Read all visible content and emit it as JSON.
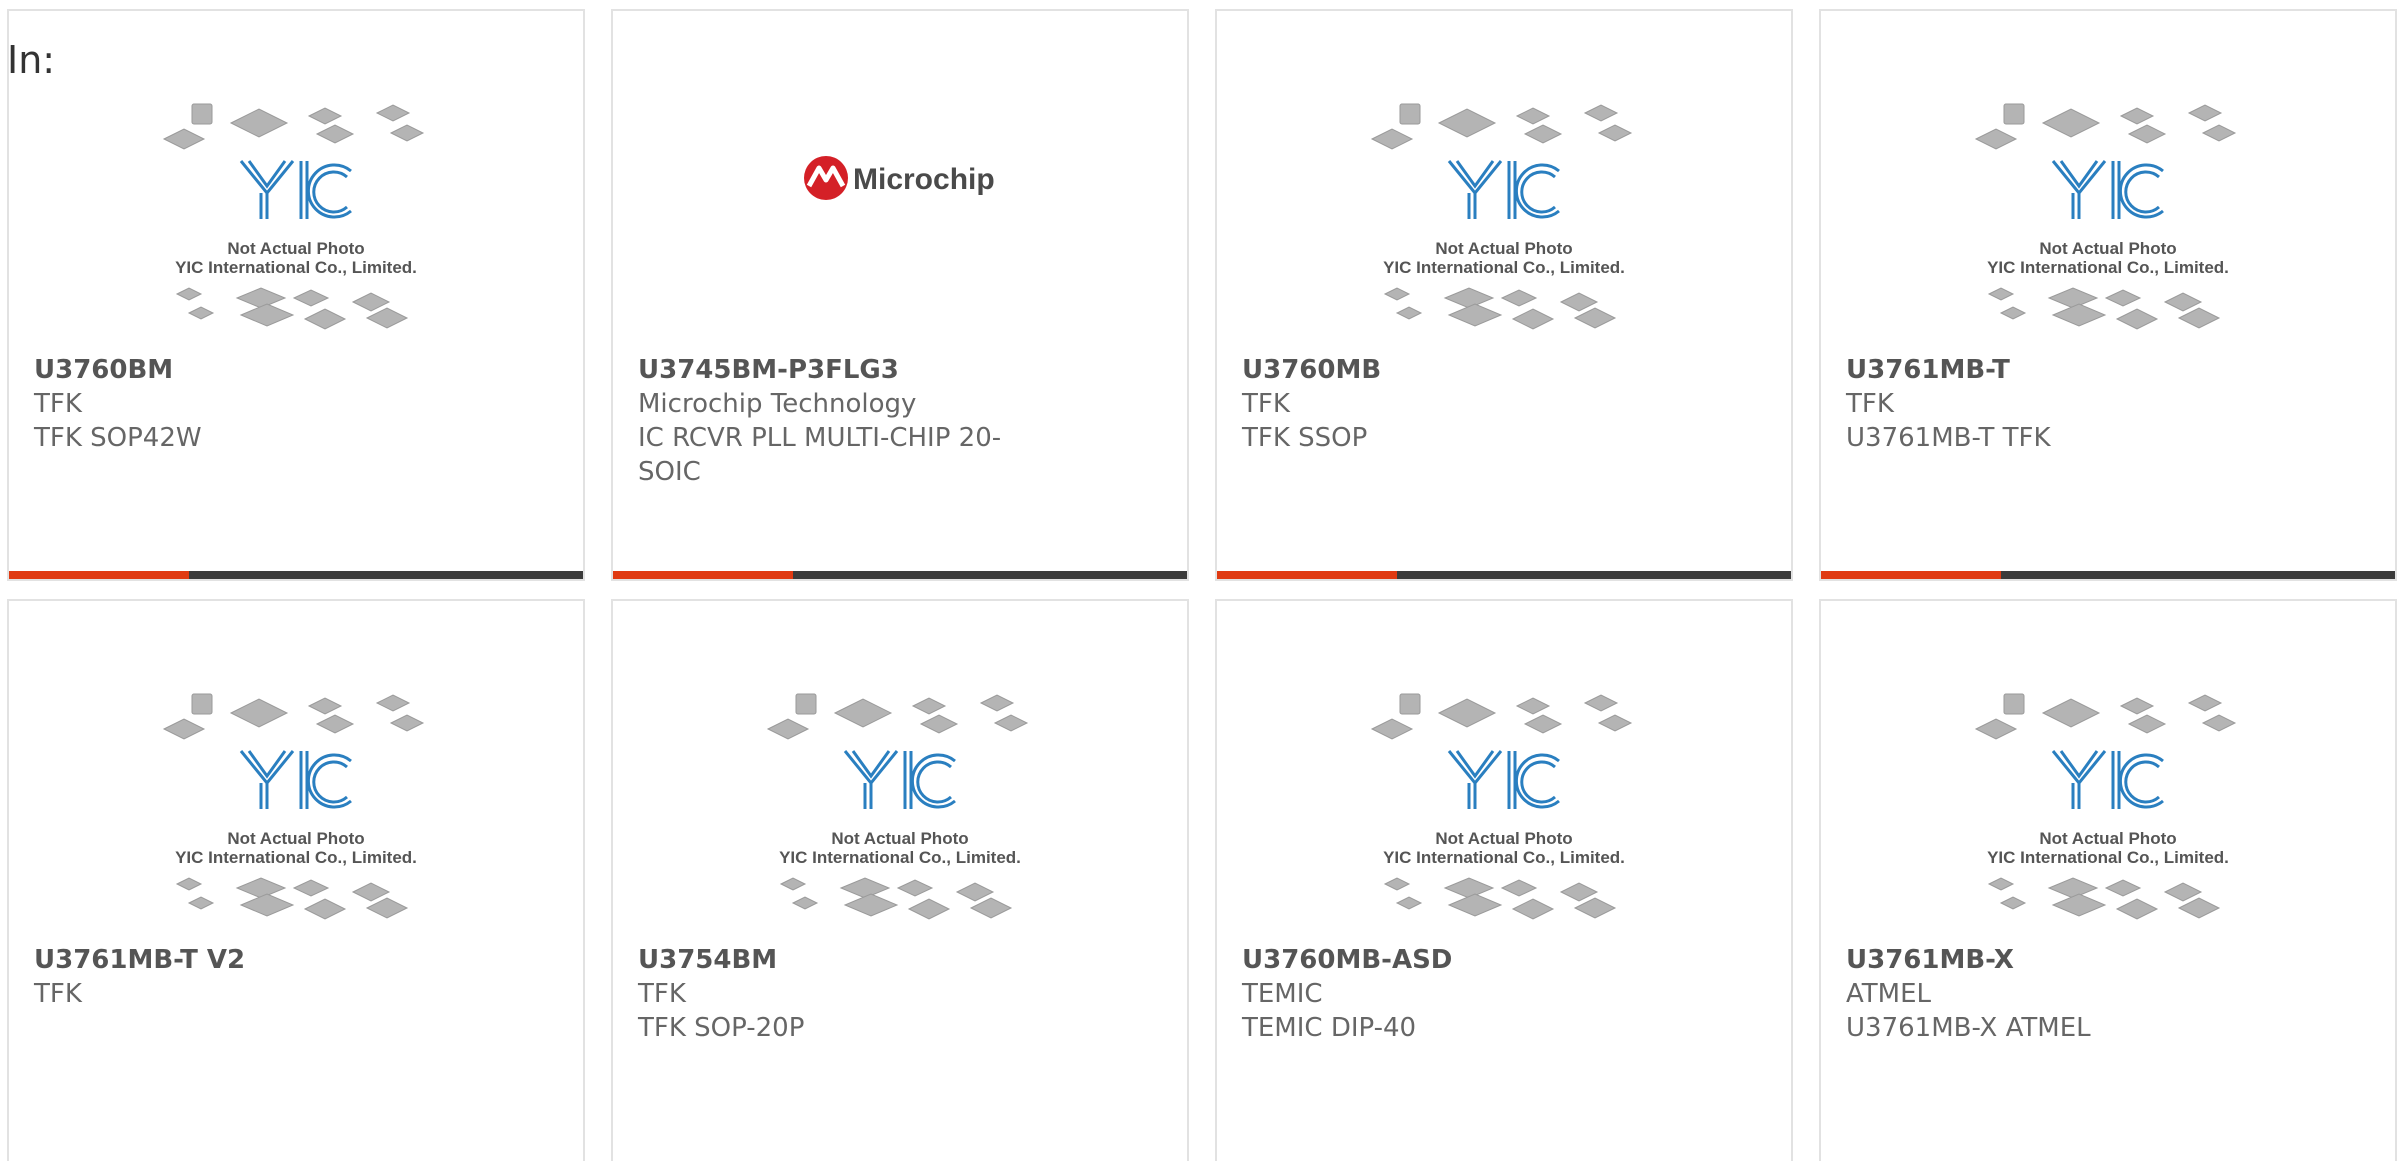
{
  "page": {
    "in_label": "In:"
  },
  "placeholder": {
    "line1": "Not Actual Photo",
    "line2": "YIC International Co., Limited.",
    "logo_text": "YIC"
  },
  "microchip_logo_text": "Microchip",
  "colors": {
    "accent": "#e03a12",
    "bar": "#3b3b3b",
    "yic_blue": "#2a7fc0",
    "microchip_red": "#d42027"
  },
  "products": [
    {
      "part": "U3760BM",
      "mfr": "TFK",
      "desc": "TFK SOP42W",
      "image": "yic-placeholder"
    },
    {
      "part": "U3745BM-P3FLG3",
      "mfr": "Microchip Technology",
      "desc": "IC RCVR PLL MULTI-CHIP 20-SOIC",
      "image": "microchip-logo"
    },
    {
      "part": "U3760MB",
      "mfr": "TFK",
      "desc": "TFK SSOP",
      "image": "yic-placeholder"
    },
    {
      "part": "U3761MB-T",
      "mfr": "TFK",
      "desc": "U3761MB-T TFK",
      "image": "yic-placeholder"
    },
    {
      "part": "U3761MB-T V2",
      "mfr": "TFK",
      "desc": "",
      "image": "yic-placeholder"
    },
    {
      "part": "U3754BM",
      "mfr": "TFK",
      "desc": "TFK SOP-20P",
      "image": "yic-placeholder"
    },
    {
      "part": "U3760MB-ASD",
      "mfr": "TEMIC",
      "desc": "TEMIC DIP-40",
      "image": "yic-placeholder"
    },
    {
      "part": "U3761MB-X",
      "mfr": "ATMEL",
      "desc": "U3761MB-X ATMEL",
      "image": "yic-placeholder"
    }
  ]
}
